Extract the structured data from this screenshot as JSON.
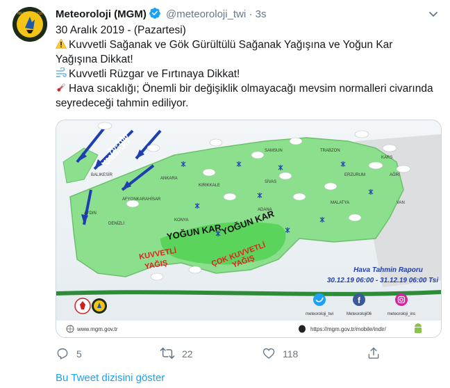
{
  "author": {
    "name": "Meteoroloji (MGM)",
    "handle": "@meteoroloji_twi",
    "time": "3s",
    "separator": "·",
    "avatar_text": "METEOROLOJİ"
  },
  "tweet": {
    "date_line": "30 Aralık 2019 - (Pazartesi)",
    "line1": "Kuvvetli Sağanak ve Gök Gürültülü Sağanak Yağışına ve Yoğun Kar Yağışına Dikkat!",
    "line2": "Kuvvetli Rüzgar ve Fırtınaya Dikkat!",
    "line3": "Hava sıcaklığı;   Önemli bir değişiklik olmayacağı mevsim normalleri civarında seyredeceği tahmin ediliyor."
  },
  "map": {
    "wind_label_1": "70-100",
    "wind_label_2": "KM/SAAT",
    "snow_label_1": "YOĞUN KAR",
    "snow_label_2": "YOĞUN KAR",
    "rain_label_1": "KUVVETLİ",
    "rain_label_1b": "YAĞIŞ",
    "rain_label_2": "ÇOK KUVVETLİ",
    "rain_label_2b": "YAĞIŞ",
    "report_title": "Hava Tahmin Raporu",
    "report_range": "30.12.19 06:00 - 31.12.19 06:00 Tsi",
    "footer_url": "www.mgm.gov.tr",
    "footer_app_url": "https://mgm.gov.tr/mobile/indir/",
    "social_1": "meteoroloji_twi",
    "social_2": "Meteoroloji06",
    "social_3": "meteoroloji_ins",
    "cities": [
      "ANKARA",
      "KIRIKKALE",
      "SİVAS",
      "TRABZON",
      "KARS",
      "AĞRI",
      "VAN",
      "MALATYA",
      "KONYA",
      "BALIKESİR",
      "AFYONKARAHİSAR",
      "DENİZLİ",
      "AYDIN",
      "ADANA",
      "ERZURUM",
      "SAMSUN"
    ]
  },
  "actions": {
    "reply_count": "5",
    "retweet_count": "22",
    "like_count": "118"
  },
  "show_thread": "Bu Tweet dizisini göster",
  "colors": {
    "accent": "#1da1f2",
    "text": "#14171a",
    "muted": "#657786",
    "map_land": "#8cdf8c",
    "map_sea": "#e9eff2"
  }
}
